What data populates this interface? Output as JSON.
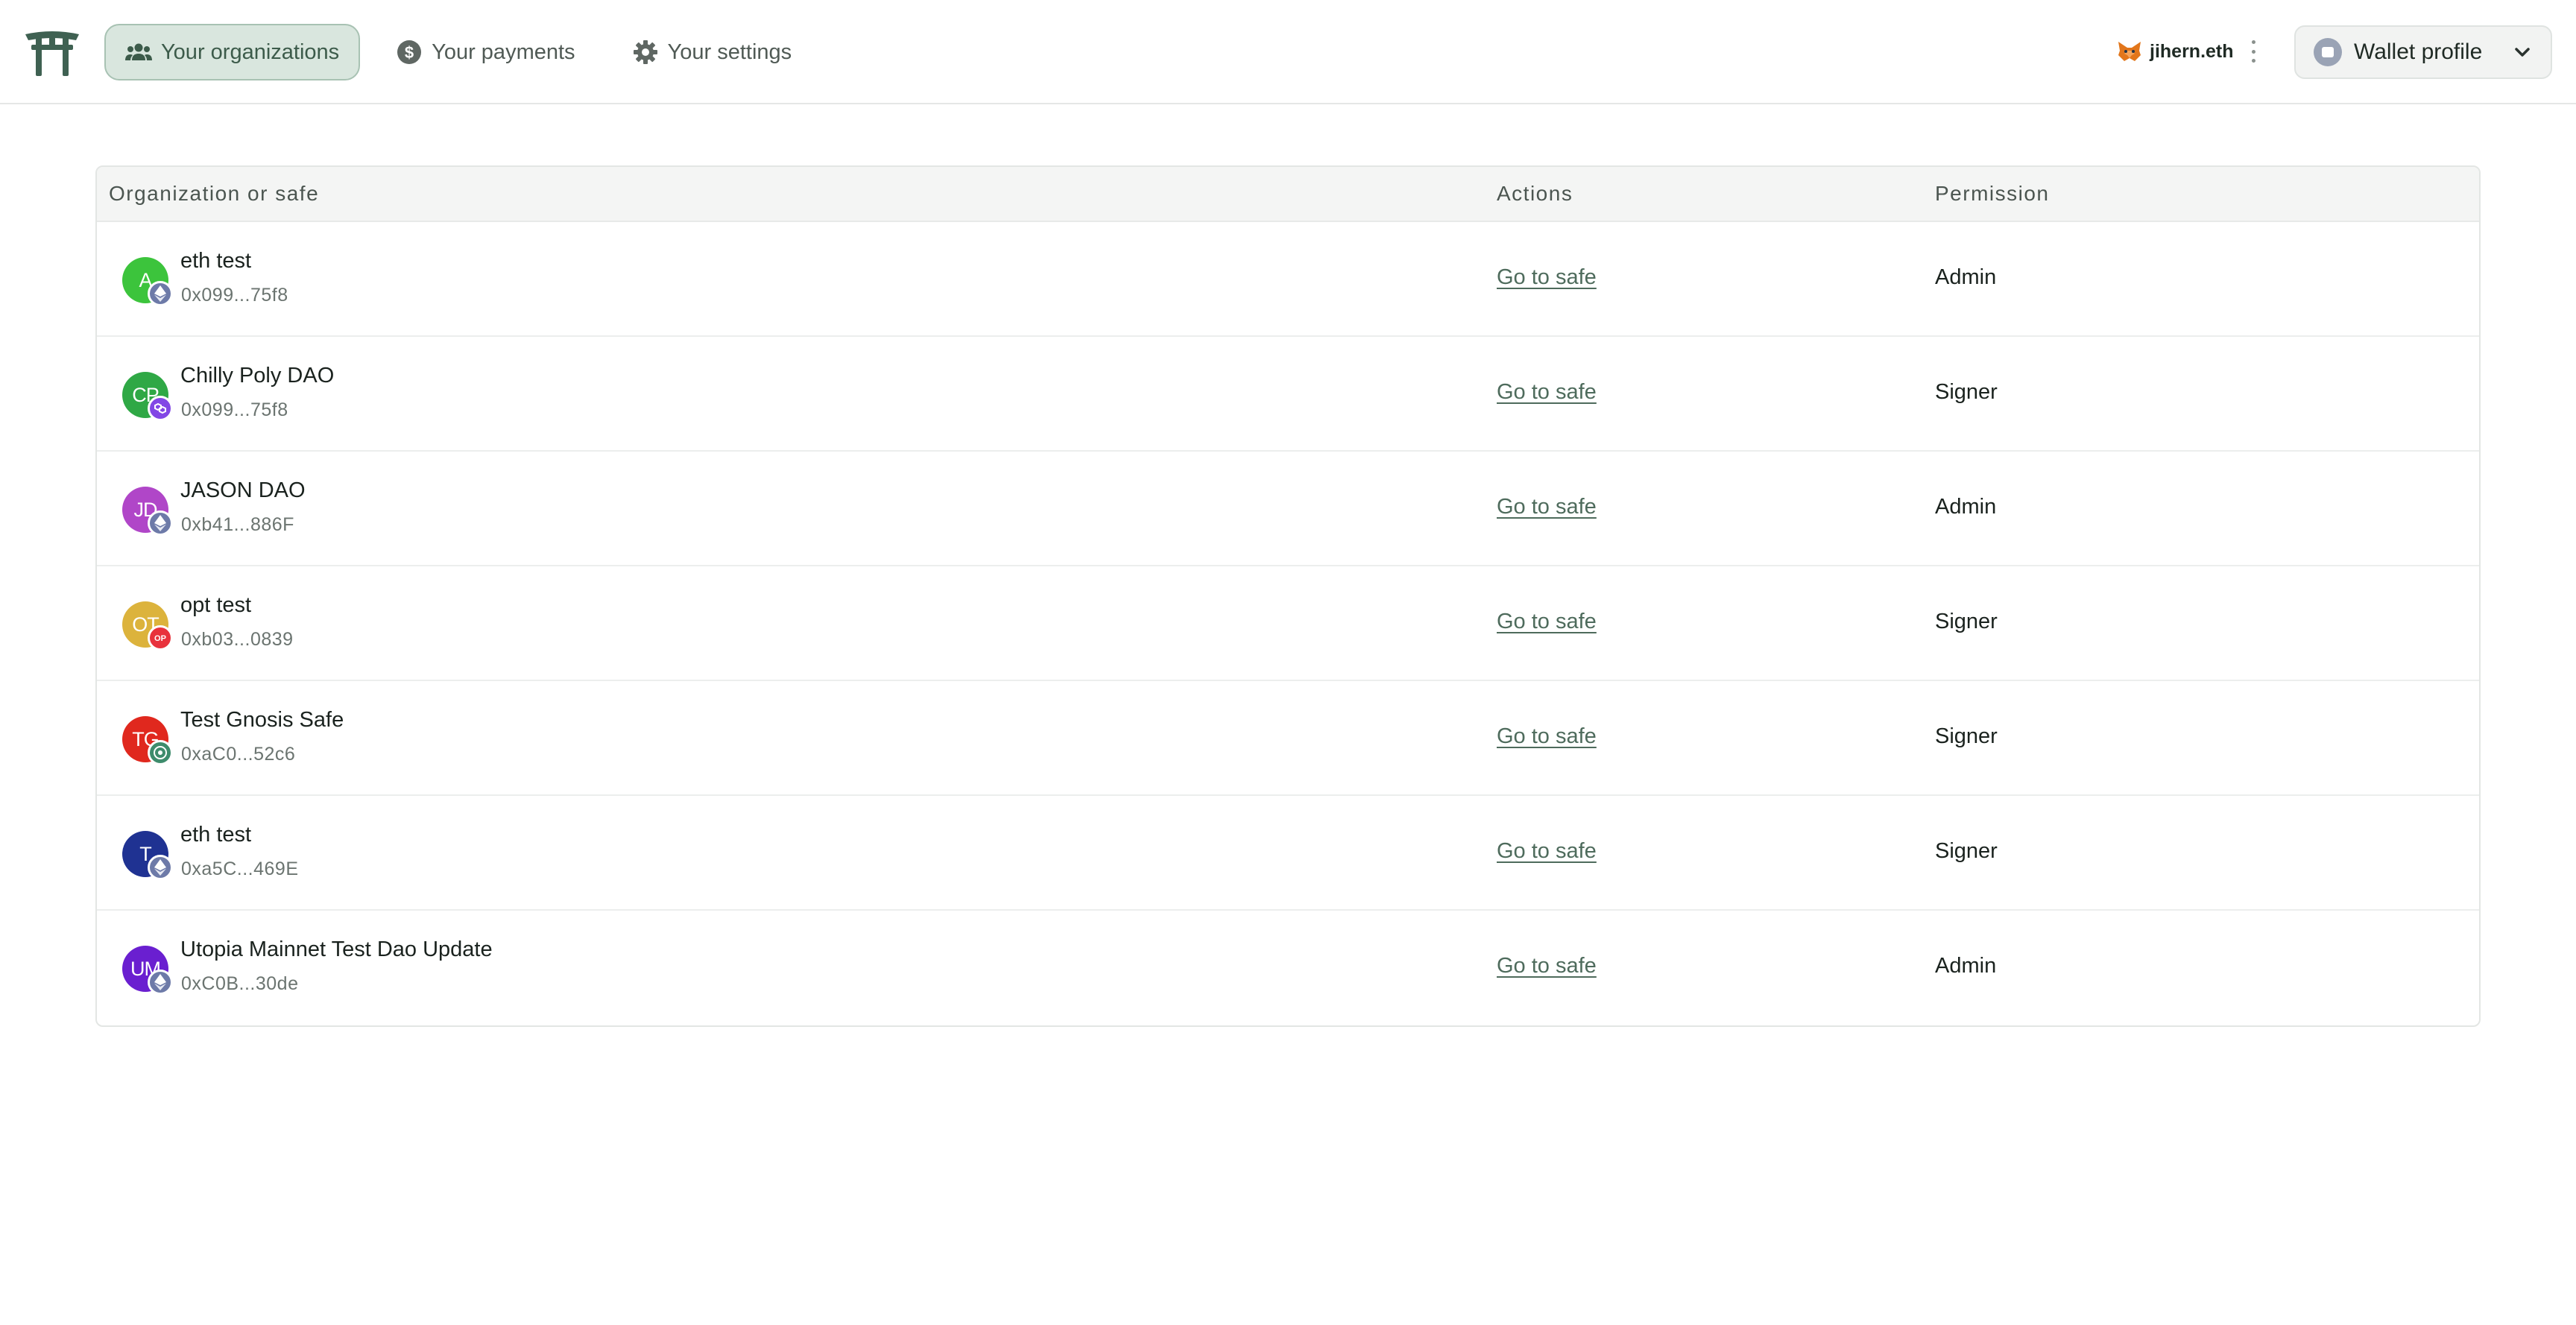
{
  "nav": {
    "items": [
      {
        "label": "Your organizations",
        "icon": "people-icon",
        "active": true
      },
      {
        "label": "Your payments",
        "icon": "dollar-icon",
        "active": false
      },
      {
        "label": "Your settings",
        "icon": "gear-icon",
        "active": false
      }
    ]
  },
  "user": {
    "name": "jihern.eth",
    "wallet_icon": "metamask-fox-icon"
  },
  "wallet_button": {
    "label": "Wallet profile"
  },
  "table": {
    "headers": {
      "org": "Organization or safe",
      "actions": "Actions",
      "permission": "Permission"
    },
    "rows": [
      {
        "initials": "A",
        "name": "eth test",
        "address": "0x099...75f8",
        "action": "Go to safe",
        "permission": "Admin",
        "avatar_color": "#3cc43c",
        "chain": "ethereum",
        "chain_color": "#6d7aa8"
      },
      {
        "initials": "CP",
        "name": "Chilly Poly DAO",
        "address": "0x099...75f8",
        "action": "Go to safe",
        "permission": "Signer",
        "avatar_color": "#2fa845",
        "chain": "polygon",
        "chain_color": "#8247e5"
      },
      {
        "initials": "JD",
        "name": "JASON DAO",
        "address": "0xb41...886F",
        "action": "Go to safe",
        "permission": "Admin",
        "avatar_color": "#b046c8",
        "chain": "ethereum",
        "chain_color": "#6d7aa8"
      },
      {
        "initials": "OT",
        "name": "opt test",
        "address": "0xb03...0839",
        "action": "Go to safe",
        "permission": "Signer",
        "avatar_color": "#dcb33c",
        "chain": "optimism",
        "chain_color": "#e8323c"
      },
      {
        "initials": "TG",
        "name": "Test Gnosis Safe",
        "address": "0xaC0...52c6",
        "action": "Go to safe",
        "permission": "Signer",
        "avatar_color": "#e0281e",
        "chain": "gnosis",
        "chain_color": "#3e8c6c"
      },
      {
        "initials": "T",
        "name": "eth test",
        "address": "0xa5C...469E",
        "action": "Go to safe",
        "permission": "Signer",
        "avatar_color": "#1f3292",
        "chain": "ethereum",
        "chain_color": "#6d7aa8"
      },
      {
        "initials": "UM",
        "name": "Utopia Mainnet Test Dao Update",
        "address": "0xC0B...30de",
        "action": "Go to safe",
        "permission": "Admin",
        "avatar_color": "#6a1fd0",
        "chain": "ethereum",
        "chain_color": "#6d7aa8"
      }
    ]
  },
  "colors": {
    "accent": "#3c5b4a",
    "active_nav_bg": "#d9e6de",
    "link": "#4e6b5c"
  }
}
